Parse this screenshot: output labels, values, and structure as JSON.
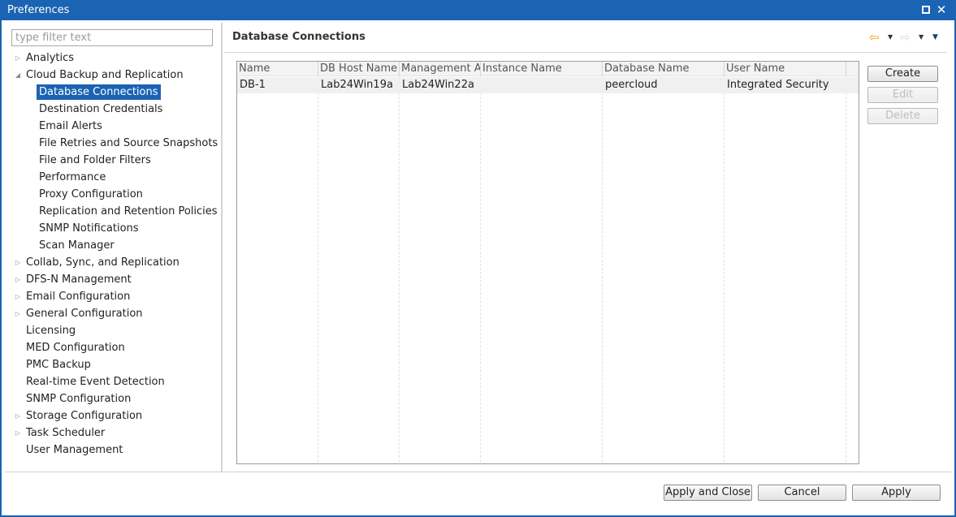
{
  "window": {
    "title": "Preferences"
  },
  "filter": {
    "placeholder": "type filter text",
    "value": ""
  },
  "tree": [
    {
      "label": "Analytics",
      "level": 0,
      "twisty": "collapsed"
    },
    {
      "label": "Cloud Backup and Replication",
      "level": 0,
      "twisty": "expanded"
    },
    {
      "label": "Database Connections",
      "level": 1,
      "twisty": "none",
      "selected": true
    },
    {
      "label": "Destination Credentials",
      "level": 1,
      "twisty": "none"
    },
    {
      "label": "Email Alerts",
      "level": 1,
      "twisty": "none"
    },
    {
      "label": "File Retries and Source Snapshots",
      "level": 1,
      "twisty": "none"
    },
    {
      "label": "File and Folder Filters",
      "level": 1,
      "twisty": "none"
    },
    {
      "label": "Performance",
      "level": 1,
      "twisty": "none"
    },
    {
      "label": "Proxy Configuration",
      "level": 1,
      "twisty": "none"
    },
    {
      "label": "Replication and Retention Policies",
      "level": 1,
      "twisty": "none"
    },
    {
      "label": "SNMP Notifications",
      "level": 1,
      "twisty": "none"
    },
    {
      "label": "Scan Manager",
      "level": 1,
      "twisty": "none"
    },
    {
      "label": "Collab, Sync, and Replication",
      "level": 0,
      "twisty": "collapsed"
    },
    {
      "label": "DFS-N Management",
      "level": 0,
      "twisty": "collapsed"
    },
    {
      "label": "Email Configuration",
      "level": 0,
      "twisty": "collapsed"
    },
    {
      "label": "General Configuration",
      "level": 0,
      "twisty": "collapsed"
    },
    {
      "label": "Licensing",
      "level": 0,
      "twisty": "none"
    },
    {
      "label": "MED Configuration",
      "level": 0,
      "twisty": "none"
    },
    {
      "label": "PMC Backup",
      "level": 0,
      "twisty": "none"
    },
    {
      "label": "Real-time Event Detection",
      "level": 0,
      "twisty": "none"
    },
    {
      "label": "SNMP Configuration",
      "level": 0,
      "twisty": "none"
    },
    {
      "label": "Storage Configuration",
      "level": 0,
      "twisty": "collapsed"
    },
    {
      "label": "Task Scheduler",
      "level": 0,
      "twisty": "collapsed"
    },
    {
      "label": "User Management",
      "level": 0,
      "twisty": "none"
    }
  ],
  "page": {
    "title": "Database Connections",
    "icons": [
      "back-arrow-icon",
      "back-dropdown-icon",
      "forward-arrow-icon",
      "forward-dropdown-icon",
      "view-menu-icon"
    ]
  },
  "table": {
    "columns": [
      "Name",
      "DB Host Name",
      "Management Agent",
      "Instance Name",
      "Database Name",
      "User Name"
    ],
    "rows": [
      [
        "DB-1",
        "Lab24Win19a",
        "Lab24Win22a",
        "",
        "peercloud",
        "Integrated Security"
      ]
    ]
  },
  "side_buttons": {
    "create": "Create",
    "edit": "Edit",
    "delete": "Delete"
  },
  "footer": {
    "apply_close": "Apply and Close",
    "cancel": "Cancel",
    "apply": "Apply"
  },
  "colors": {
    "title_bar": "#1b63b3",
    "selection": "#1b63b3",
    "back_arrow": "#e8a317"
  }
}
